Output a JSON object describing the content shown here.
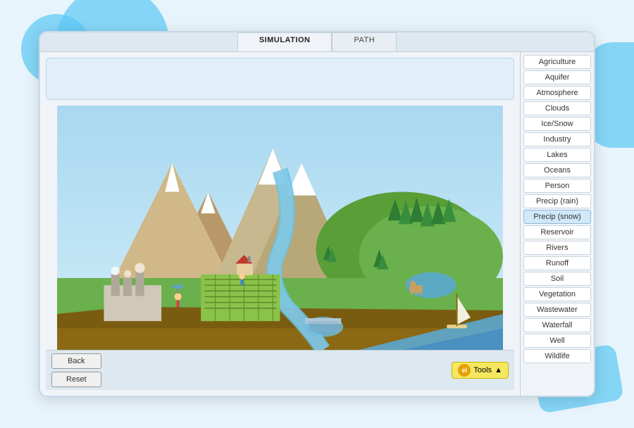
{
  "tabs": [
    {
      "label": "SIMULATION",
      "active": true
    },
    {
      "label": "PATH",
      "active": false
    }
  ],
  "sidebar_items": [
    {
      "label": "Agriculture",
      "highlighted": false
    },
    {
      "label": "Aquifer",
      "highlighted": false
    },
    {
      "label": "Atmosphere",
      "highlighted": false
    },
    {
      "label": "Clouds",
      "highlighted": false
    },
    {
      "label": "Ice/Snow",
      "highlighted": false
    },
    {
      "label": "Industry",
      "highlighted": false
    },
    {
      "label": "Lakes",
      "highlighted": false
    },
    {
      "label": "Oceans",
      "highlighted": false
    },
    {
      "label": "Person",
      "highlighted": false
    },
    {
      "label": "Precip (rain)",
      "highlighted": false
    },
    {
      "label": "Precip (snow)",
      "highlighted": true
    },
    {
      "label": "Reservoir",
      "highlighted": false
    },
    {
      "label": "Rivers",
      "highlighted": false
    },
    {
      "label": "Runoff",
      "highlighted": false
    },
    {
      "label": "Soil",
      "highlighted": false
    },
    {
      "label": "Vegetation",
      "highlighted": false
    },
    {
      "label": "Wastewater",
      "highlighted": false
    },
    {
      "label": "Waterfall",
      "highlighted": false
    },
    {
      "label": "Well",
      "highlighted": false
    },
    {
      "label": "Wildlife",
      "highlighted": false
    }
  ],
  "buttons": {
    "back": "Back",
    "reset": "Reset",
    "tools": "Tools"
  },
  "colors": {
    "sky_top": "#a8d8f0",
    "sky_bottom": "#d0ecf8",
    "ground_green": "#6ab04c",
    "ground_dark": "#8b6914",
    "water": "#5ba8d0",
    "mountain_snow": "#ffffff",
    "mountain_rock": "#c8a87a"
  }
}
